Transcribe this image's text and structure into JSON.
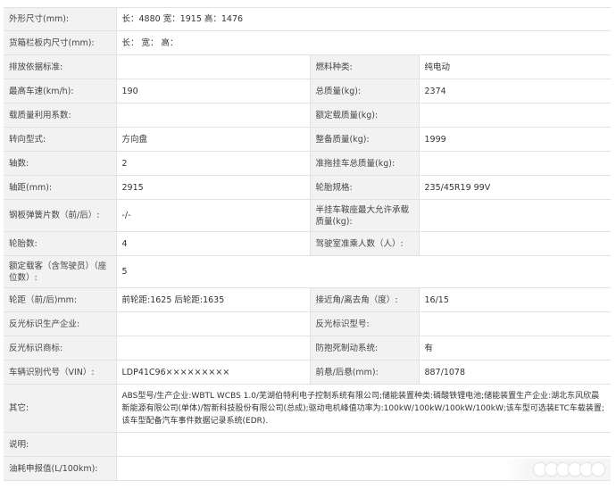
{
  "rows": {
    "r1": {
      "label": "外形尺寸(mm):",
      "value": "长：4880 宽：1915 高：1476"
    },
    "r2": {
      "label": "货箱栏板内尺寸(mm):",
      "value": "长： 宽： 高："
    },
    "r3": {
      "l1": "排放依据标准:",
      "v1": "",
      "l2": "燃料种类:",
      "v2": "纯电动"
    },
    "r4": {
      "l1": "最高车速(km/h):",
      "v1": "190",
      "l2": "总质量(kg):",
      "v2": "2374"
    },
    "r5": {
      "l1": "载质量利用系数:",
      "v1": "",
      "l2": "额定载质量(kg):",
      "v2": ""
    },
    "r6": {
      "l1": "转向型式:",
      "v1": "方向盘",
      "l2": "整备质量(kg):",
      "v2": "1999"
    },
    "r7": {
      "l1": "轴数:",
      "v1": "2",
      "l2": "准拖挂车总质量(kg):",
      "v2": ""
    },
    "r8": {
      "l1": "轴距(mm):",
      "v1": "2915",
      "l2": "轮胎规格:",
      "v2": "235/45R19 99V"
    },
    "r9": {
      "l1": "钢板弹簧片数（前/后）:",
      "v1": "-/-",
      "l2": "半挂车鞍座最大允许承载质量(kg):",
      "v2": ""
    },
    "r10": {
      "l1": "轮胎数:",
      "v1": "4",
      "l2": "驾驶室准乘人数（人）:",
      "v2": ""
    },
    "r11": {
      "label": "额定载客（含驾驶员）（座位数）:",
      "value": "5"
    },
    "r12": {
      "l1": "轮距（前/后)mm:",
      "v1": "前轮距:1625 后轮距:1635",
      "l2": "接近角/离去角（度）:",
      "v2": "16/15"
    },
    "r13": {
      "l1": "反光标识生产企业:",
      "v1": "",
      "l2": "反光标识型号:",
      "v2": ""
    },
    "r14": {
      "l1": "反光标识商标:",
      "v1": "",
      "l2": "防抱死制动系统:",
      "v2": "有"
    },
    "r15": {
      "l1": "车辆识别代号（VIN）:",
      "v1": "LDP41C96×××××××××",
      "l2": "前悬/后悬(mm):",
      "v2": "887/1078"
    },
    "r16": {
      "label": "其它:",
      "value": "ABS型号/生产企业:WBTL WCBS 1.0/芜湖伯特利电子控制系统有限公司;储能装置种类:磷酸铁锂电池;储能装置生产企业:湖北东风欣晨新能源有限公司(单体)/智新科技股份有限公司(总成);驱动电机峰值功率为:100kW/100kW/100kW/100kW;该车型可选装ETC车载装置;该车型配备汽车事件数据记录系统(EDR)."
    },
    "r17": {
      "label": "说明:",
      "value": ""
    },
    "r18": {
      "label": "油耗申报值(L/100km):",
      "value": ""
    }
  }
}
